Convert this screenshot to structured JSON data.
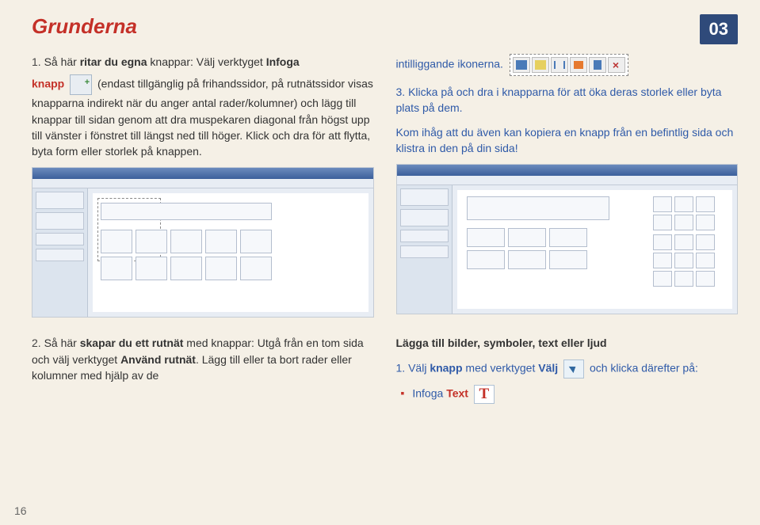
{
  "header": {
    "title": "Grunderna",
    "page_badge": "03"
  },
  "left": {
    "p1_num": "1.",
    "p1_a": "Så här ",
    "p1_b": "ritar du egna",
    "p1_c": " knappar: Välj verktyget ",
    "p1_d": "Infoga",
    "p2_a": "knapp",
    "p2_b": " (endast tillgänglig på frihandssidor, på rutnätssidor visas knapparna indirekt när du anger antal rader/kolumner) och lägg till knappar till sidan genom att dra muspekaren diagonal från högst upp till vänster i fönstret till längst ned till höger. Klick och dra för att flytta, byta form eller storlek på knappen."
  },
  "right": {
    "p1": "intilliggande ikonerna.",
    "p2_num": "3.",
    "p2": "Klicka på och dra i knapparna för att öka deras storlek eller byta plats på dem.",
    "p3": "Kom ihåg att du även kan kopiera en knapp från en befintlig sida och klistra in den på din sida!"
  },
  "lower_left": {
    "p1_num": "2.",
    "p1_a": "Så här ",
    "p1_b": "skapar du ett rutnät",
    "p1_c": " med knappar: Utgå från en tom sida och välj verktyget ",
    "p1_d": "Använd rutnät",
    "p1_e": ". Lägg till eller ta bort rader eller kolumner med hjälp av de"
  },
  "lower_right": {
    "heading": "Lägga till bilder, symboler, text eller ljud",
    "p1_num": "1.",
    "p1_a": "Välj ",
    "p1_b": "knapp",
    "p1_c": " med verktyget ",
    "p1_d": "Välj",
    "p1_e": " och klicka därefter på:",
    "li1_a": "Infoga ",
    "li1_b": "Text"
  },
  "page_number": "16"
}
